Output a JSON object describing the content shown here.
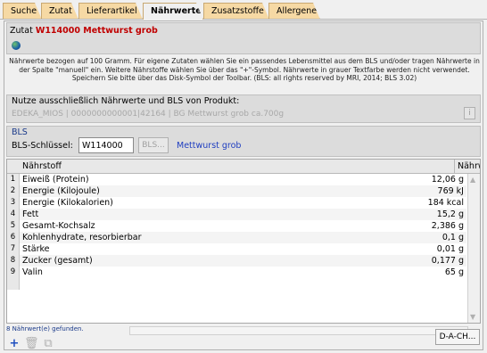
{
  "tabs": [
    "Suche",
    "Zutat",
    "Lieferartikel",
    "Nährwerte",
    "Zusatzstoffe",
    "Allergene"
  ],
  "active_tab": "Nährwerte",
  "zutat": {
    "label": "Zutat",
    "name": "W114000 Mettwurst grob"
  },
  "info_text": "Nährwerte bezogen auf 100 Gramm. Für eigene Zutaten wählen Sie ein passendes Lebensmittel aus dem BLS und/oder tragen Nährwerte in der Spalte \"manuell\" ein. Weitere Nährstoffe wählen Sie über das \"+\"-Symbol. Nährwerte in grauer Textfarbe werden nicht verwendet. Speichern Sie bitte über das Disk-Symbol der Toolbar. (BLS: all rights reserved by MRI, 2014; BLS 3.02)",
  "produkt": {
    "title": "Nutze ausschließlich Nährwerte und BLS von Produkt:",
    "value": "EDEKA_MIOS | 0000000000001|42164 | BG Mettwurst grob ca.700g",
    "info_label": "i"
  },
  "bls": {
    "title": "BLS",
    "label": "BLS-Schlüssel:",
    "input_value": "W114000",
    "button_label": "BLS...",
    "result": "Mettwurst grob"
  },
  "table": {
    "headers": [
      "Nährstoff",
      "Nährwert"
    ],
    "rows": [
      {
        "n": "1",
        "name": "Eiweiß (Protein)",
        "value": "12,06 g"
      },
      {
        "n": "2",
        "name": "Energie (Kilojoule)",
        "value": "769 kJ"
      },
      {
        "n": "3",
        "name": "Energie (Kilokalorien)",
        "value": "184 kcal"
      },
      {
        "n": "4",
        "name": "Fett",
        "value": "15,2 g"
      },
      {
        "n": "5",
        "name": "Gesamt-Kochsalz",
        "value": "2,386 g"
      },
      {
        "n": "6",
        "name": "Kohlenhydrate, resorbierbar",
        "value": "0,1 g"
      },
      {
        "n": "7",
        "name": "Stärke",
        "value": "0,01 g"
      },
      {
        "n": "8",
        "name": "Zucker (gesamt)",
        "value": "0,177 g"
      },
      {
        "n": "9",
        "name": "Valin",
        "value": "65 g"
      }
    ]
  },
  "status": "8 Nährwert(e) gefunden.",
  "dach_button": "D-A-CH...",
  "icons": [
    "globe-icon",
    "info-icon",
    "add-icon",
    "delete-icon",
    "copy-icon"
  ],
  "colors": {
    "tab_bg": "#f6d9a4",
    "zutat_name": "#c00000",
    "link": "#1f3ec0"
  }
}
